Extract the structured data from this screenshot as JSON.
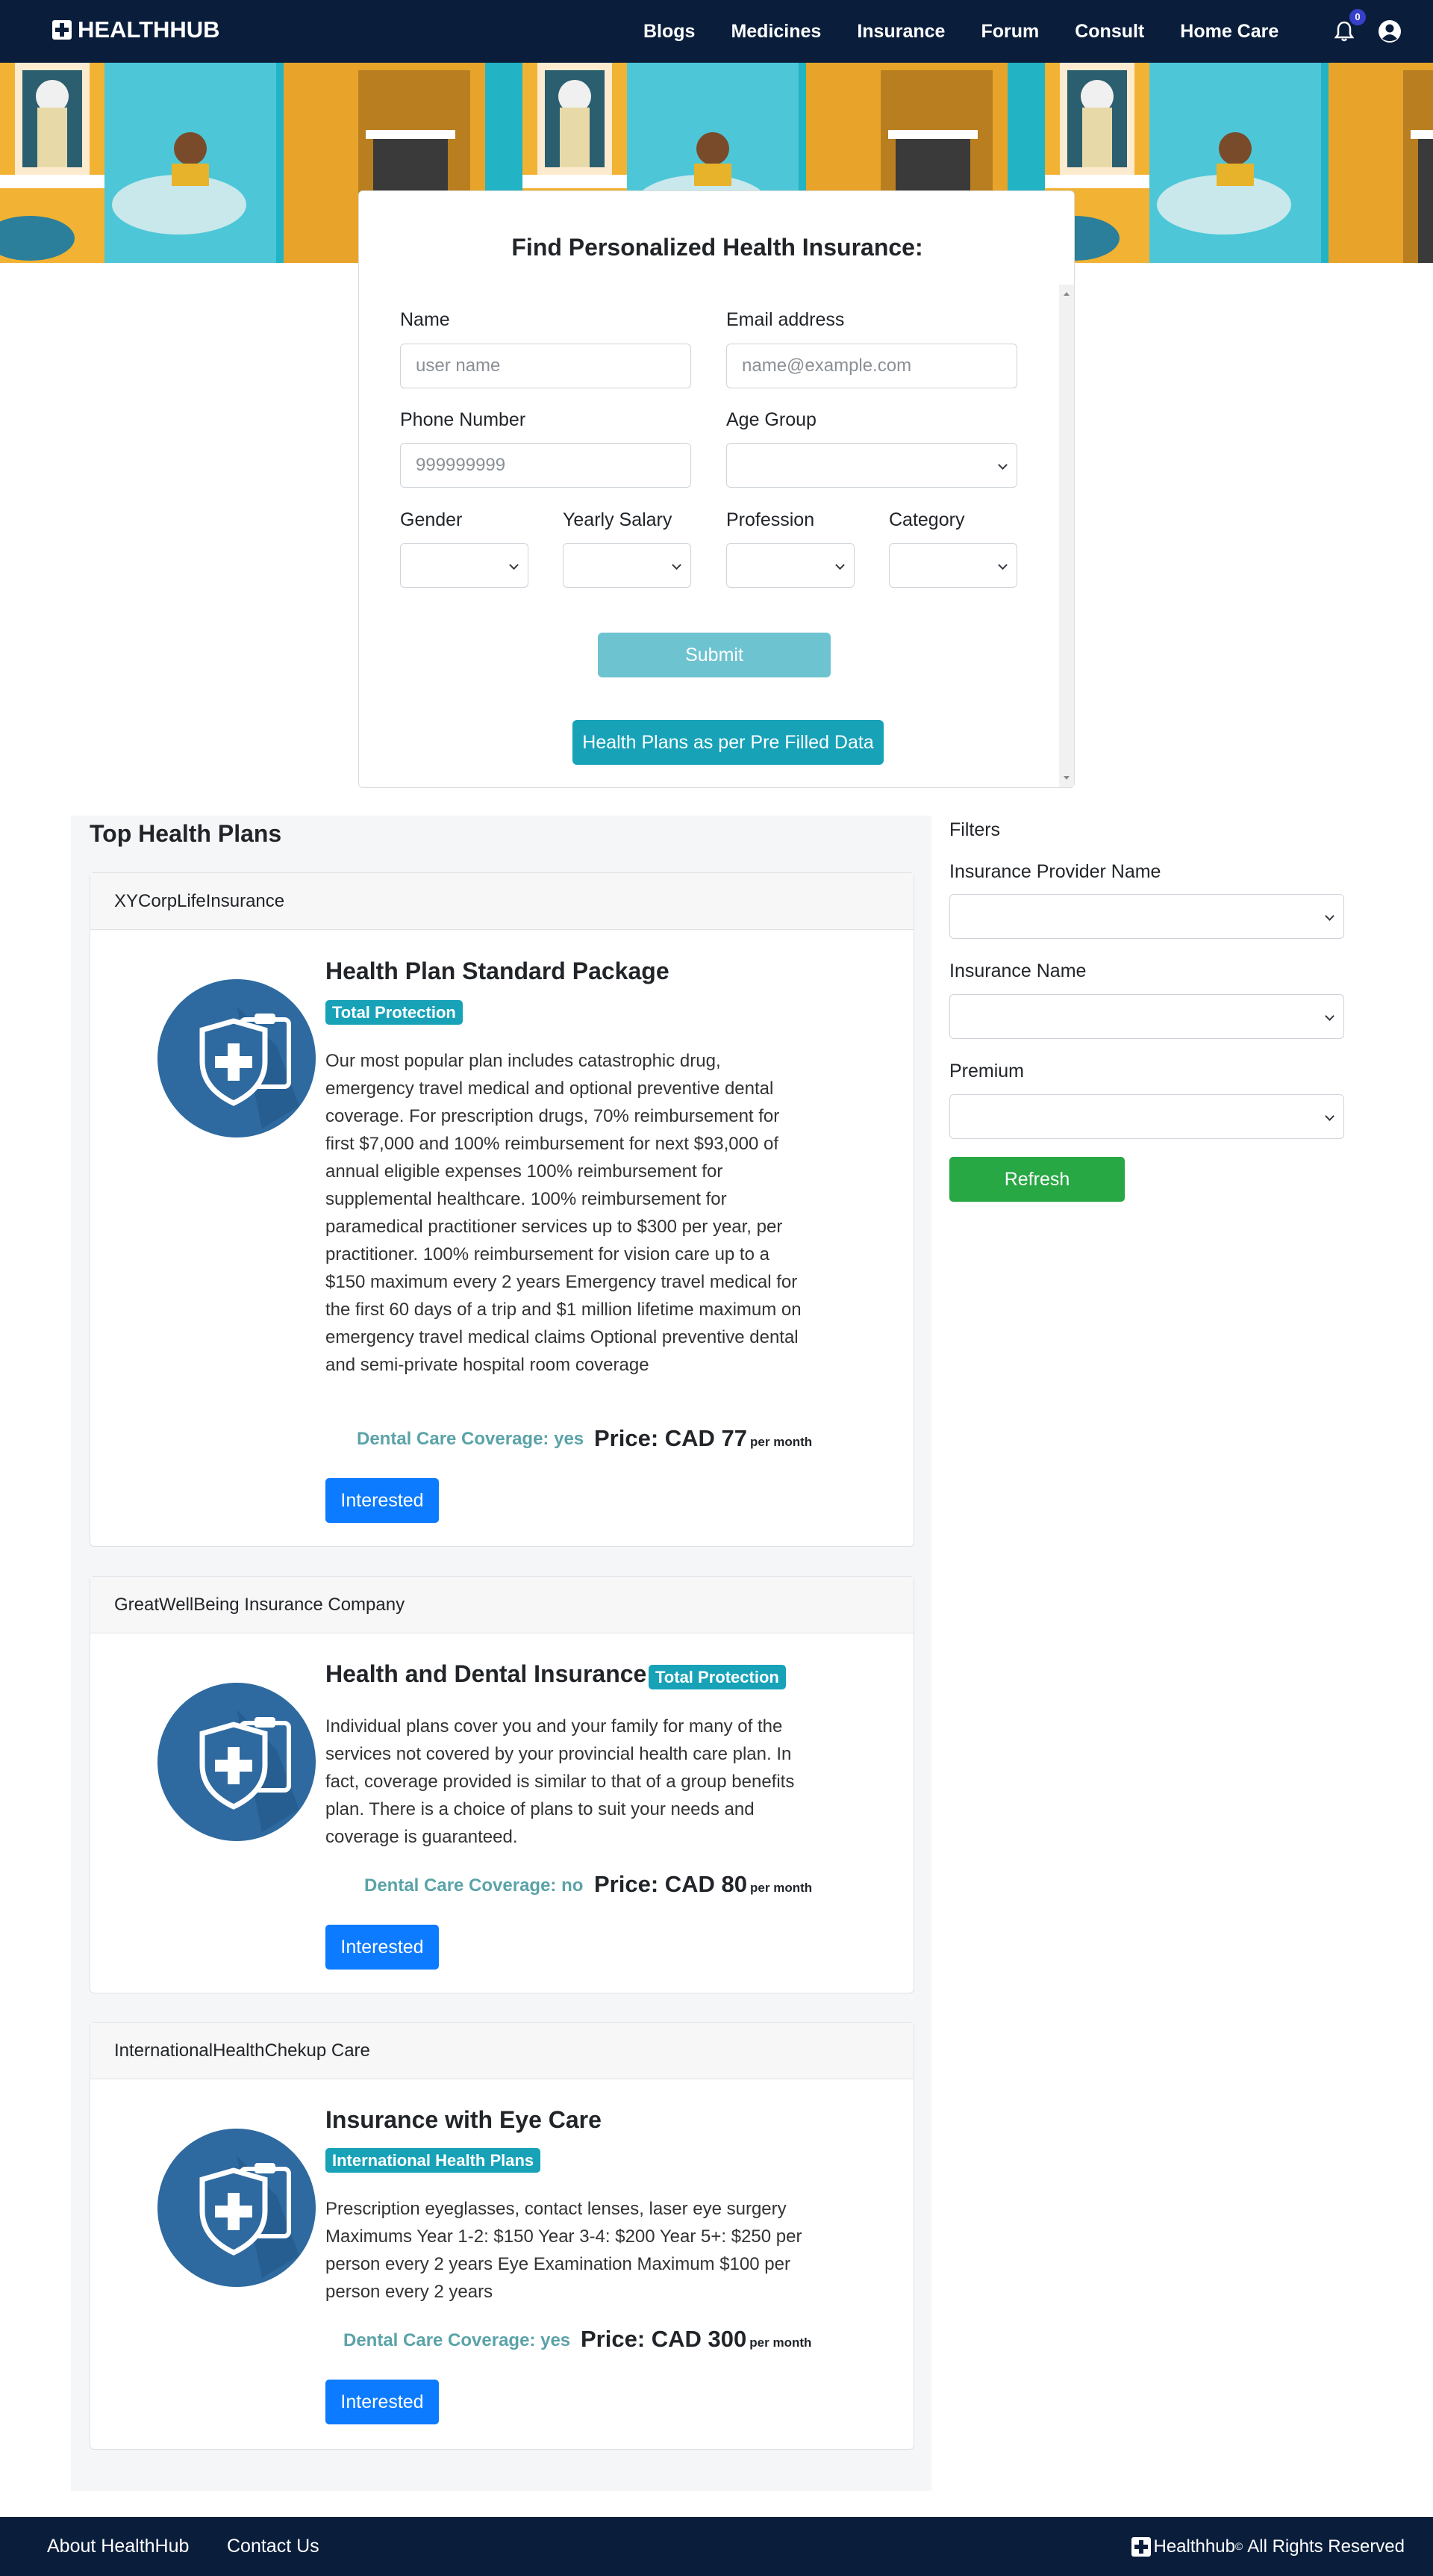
{
  "navbar": {
    "brand": "HEALTHHUB",
    "links": [
      "Blogs",
      "Medicines",
      "Insurance",
      "Forum",
      "Consult",
      "Home Care"
    ],
    "notification_count": "0",
    "icons": [
      "bell-icon",
      "account-icon"
    ]
  },
  "form": {
    "title": "Find Personalized Health Insurance:",
    "name_label": "Name",
    "name_placeholder": "user name",
    "email_label": "Email address",
    "email_placeholder": "name@example.com",
    "phone_label": "Phone Number",
    "phone_placeholder": "999999999",
    "age_label": "Age Group",
    "gender_label": "Gender",
    "salary_label": "Yearly Salary",
    "profession_label": "Profession",
    "category_label": "Category",
    "submit_label": "Submit",
    "prefill_label": "Health Plans as per Pre Filled Data"
  },
  "plans": {
    "title": "Top Health Plans",
    "items": [
      {
        "provider": "XYCorpLifeInsurance",
        "name": "Health Plan Standard Package",
        "badge": "Total Protection",
        "description": "Our most popular plan includes catastrophic drug, emergency travel medical and optional preventive dental coverage. For prescription drugs, 70% reimbursement for first $7,000 and 100% reimbursement for next $93,000 of annual eligible expenses 100% reimbursement for supplemental healthcare. 100% reimbursement for paramedical practitioner services up to $300 per year, per practitioner. 100% reimbursement for vision care up to a $150 maximum every 2 years Emergency travel medical for the first 60 days of a trip and $1 million lifetime maximum on emergency travel medical claims Optional preventive dental and semi-private hospital room coverage",
        "dental": "Dental Care Coverage: yes",
        "price": "Price: CAD 77",
        "per": "per month",
        "button": "Interested"
      },
      {
        "provider": "GreatWellBeing Insurance Company",
        "name": "Health and Dental Insurance",
        "badge": "Total Protection",
        "description": "Individual plans cover you and your family for many of the services not covered by your provincial health care plan. In fact, coverage provided is similar to that of a group benefits plan. There is a choice of plans to suit your needs and coverage is guaranteed.",
        "dental": "Dental Care Coverage: no",
        "price": "Price: CAD 80",
        "per": "per month",
        "button": "Interested"
      },
      {
        "provider": "InternationalHealthChekup Care",
        "name": "Insurance with Eye Care",
        "badge": "International Health Plans",
        "description": "Prescription eyeglasses, contact lenses, laser eye surgery Maximums Year 1-2: $150 Year 3-4: $200 Year 5+: $250 per person every 2 years Eye Examination Maximum $100 per person every 2 years",
        "dental": "Dental Care Coverage: yes",
        "price": "Price: CAD 300",
        "per": "per month",
        "button": "Interested"
      }
    ]
  },
  "filters": {
    "title": "Filters",
    "provider_label": "Insurance Provider Name",
    "insurance_label": "Insurance Name",
    "premium_label": "Premium",
    "refresh_label": "Refresh"
  },
  "footer": {
    "about": "About HealthHub",
    "contact": "Contact Us",
    "brand": "Healthhub",
    "reg": "©",
    "rights": "All Rights Reserved"
  },
  "colors": {
    "navbar": "#0a1e3c",
    "info": "#17a2b8",
    "primary": "#0d7bff",
    "success": "#28a745"
  }
}
